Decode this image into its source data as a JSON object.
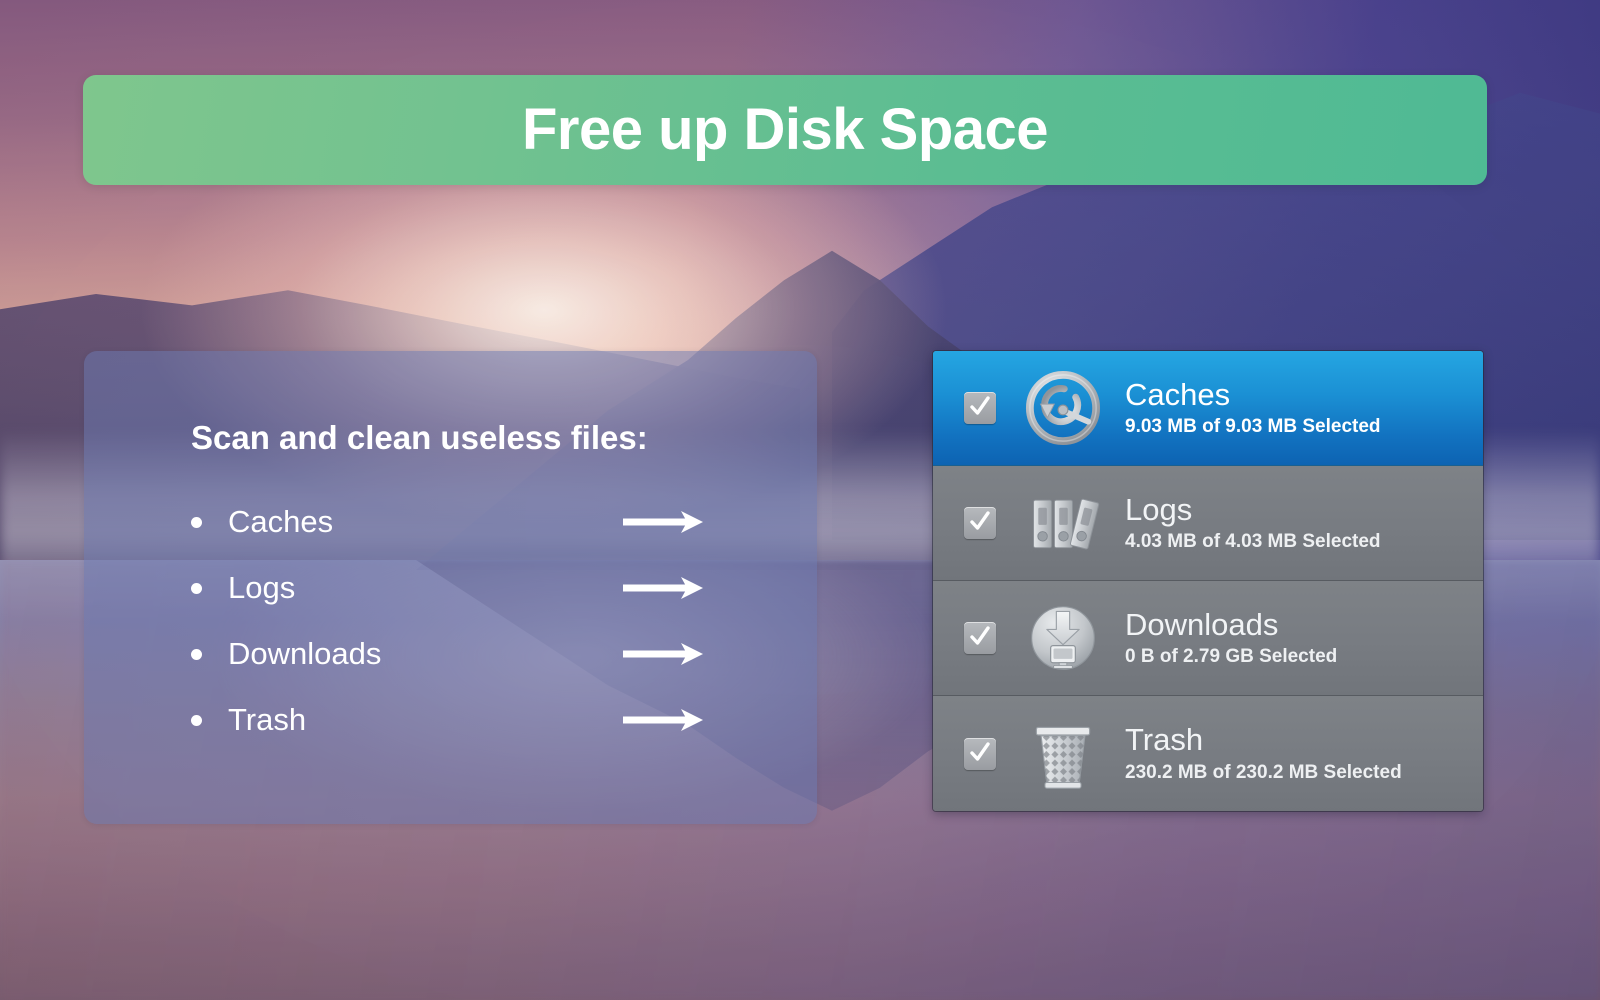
{
  "header": {
    "title": "Free up Disk Space",
    "background_color": "#5fbf90"
  },
  "left_panel": {
    "heading": "Scan and clean useless files:",
    "panel_color": "#6c78b0",
    "items": [
      {
        "label": "Caches",
        "arrow_icon": "arrow-right-icon"
      },
      {
        "label": "Logs",
        "arrow_icon": "arrow-right-icon"
      },
      {
        "label": "Downloads",
        "arrow_icon": "arrow-right-icon"
      },
      {
        "label": "Trash",
        "arrow_icon": "arrow-right-icon"
      }
    ]
  },
  "cleanup_list": {
    "selected_color": "#1b90d4",
    "row_color": "#787c82",
    "rows": [
      {
        "title": "Caches",
        "detail": "9.03 MB of 9.03 MB Selected",
        "checked": true,
        "selected": true,
        "icon": "cache-gauge-icon"
      },
      {
        "title": "Logs",
        "detail": "4.03 MB of 4.03 MB Selected",
        "checked": true,
        "selected": false,
        "icon": "log-binders-icon"
      },
      {
        "title": "Downloads",
        "detail": "0 B of 2.79 GB Selected",
        "checked": true,
        "selected": false,
        "icon": "downloads-icon"
      },
      {
        "title": "Trash",
        "detail": "230.2 MB of 230.2 MB Selected",
        "checked": true,
        "selected": false,
        "icon": "trash-can-icon"
      }
    ]
  }
}
